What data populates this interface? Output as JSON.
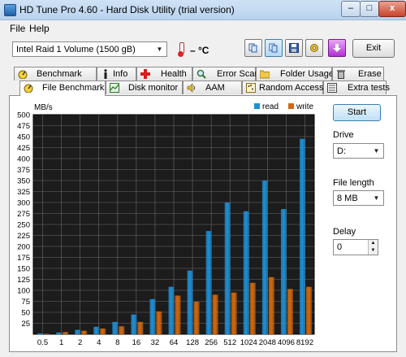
{
  "window": {
    "title": "HD Tune Pro 4.60 - Hard Disk Utility (trial version)",
    "min_label": "–",
    "max_label": "□",
    "close_label": "x"
  },
  "menu": {
    "file": "File",
    "help": "Help"
  },
  "toolbar": {
    "drive_selected": "Intel   Raid 1 Volume (1500 gB)",
    "temperature": "– °C",
    "exit_label": "Exit"
  },
  "tabs_top": [
    {
      "label": "Benchmark",
      "icon": "gauge-icon"
    },
    {
      "label": "Info",
      "icon": "info-icon"
    },
    {
      "label": "Health",
      "icon": "health-cross-icon"
    },
    {
      "label": "Error Scan",
      "icon": "magnifier-icon"
    },
    {
      "label": "Folder Usage",
      "icon": "folder-icon"
    },
    {
      "label": "Erase",
      "icon": "trash-icon"
    }
  ],
  "tabs_bottom": [
    {
      "label": "File Benchmark",
      "icon": "file-benchmark-icon",
      "active": true
    },
    {
      "label": "Disk monitor",
      "icon": "chart-icon"
    },
    {
      "label": "AAM",
      "icon": "speaker-icon"
    },
    {
      "label": "Random Access",
      "icon": "random-access-icon"
    },
    {
      "label": "Extra tests",
      "icon": "extra-tests-icon"
    }
  ],
  "side": {
    "start_label": "Start",
    "drive_label": "Drive",
    "drive_value": "D:",
    "file_length_label": "File length",
    "file_length_value": "8 MB",
    "delay_label": "Delay",
    "delay_value": "0"
  },
  "colors": {
    "read": "#1e90d6",
    "write": "#d2690e",
    "plot_bg": "#1c1c1c",
    "grid": "#6a6a6a"
  },
  "chart_data": {
    "type": "bar",
    "ylabel": "MB/s",
    "ylim": [
      0,
      500
    ],
    "y_ticks": [
      0,
      25,
      50,
      75,
      100,
      125,
      150,
      175,
      200,
      225,
      250,
      275,
      300,
      325,
      350,
      375,
      400,
      425,
      450,
      475,
      500
    ],
    "y_tick_labels": [
      "",
      "25",
      "50",
      "75",
      "100",
      "125",
      "150",
      "175",
      "200",
      "225",
      "250",
      "275",
      "300",
      "325",
      "350",
      "375",
      "400",
      "425",
      "450",
      "475",
      "500"
    ],
    "categories": [
      "0.5",
      "1",
      "2",
      "4",
      "8",
      "16",
      "32",
      "64",
      "128",
      "256",
      "512",
      "1024",
      "2048",
      "4096",
      "8192"
    ],
    "legend_position": "top-right",
    "grid": true,
    "series": [
      {
        "name": "read",
        "values": [
          2,
          4,
          10,
          17,
          28,
          45,
          80,
          108,
          145,
          235,
          300,
          280,
          350,
          285,
          445
        ]
      },
      {
        "name": "write",
        "values": [
          1,
          5,
          8,
          13,
          18,
          28,
          52,
          88,
          74,
          90,
          95,
          117,
          130,
          103,
          108
        ]
      }
    ]
  }
}
